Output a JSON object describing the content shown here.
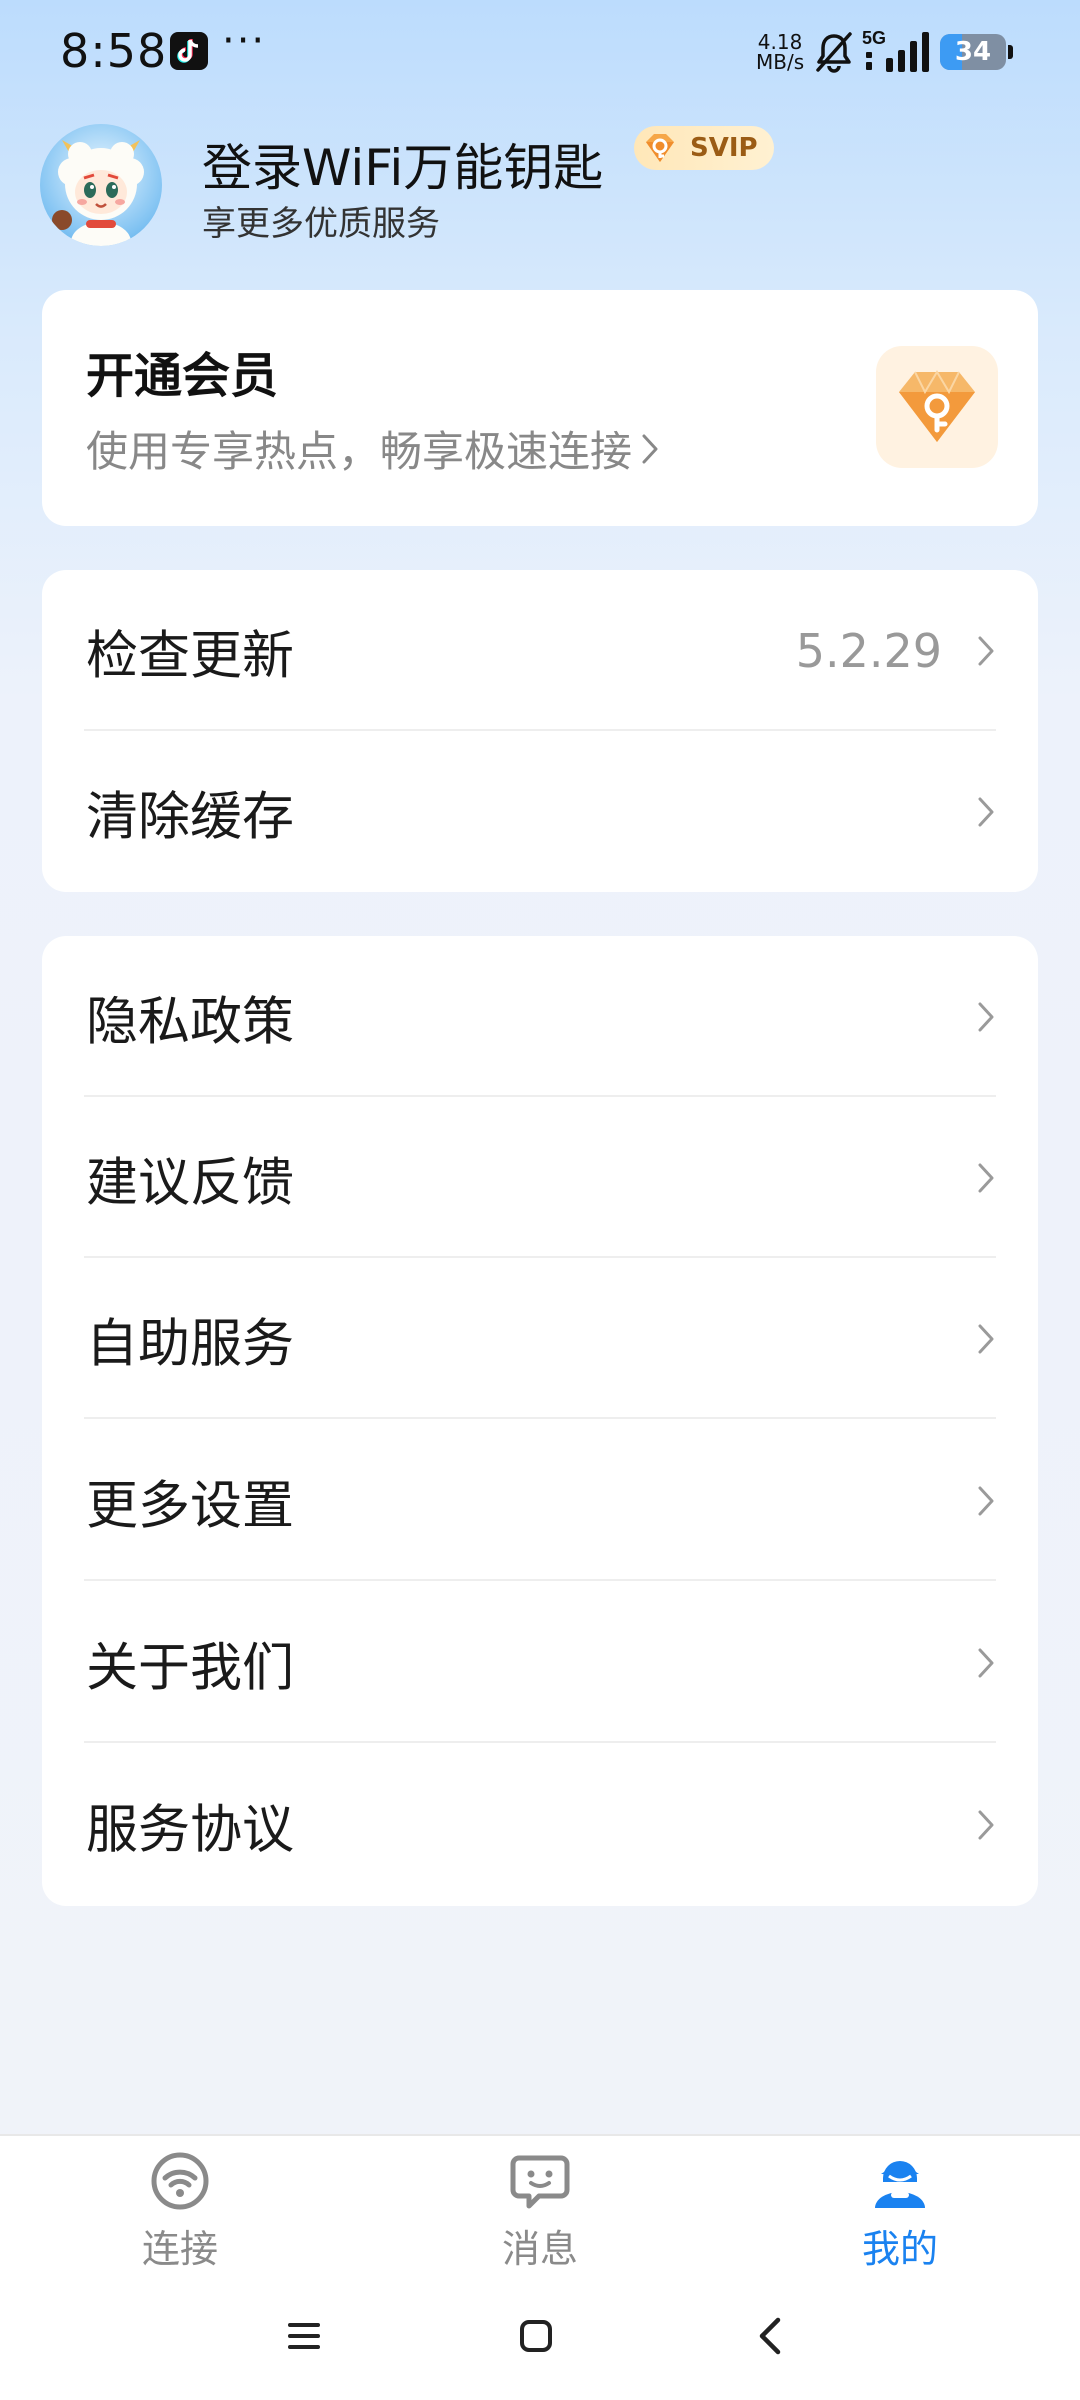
{
  "status_bar": {
    "time": "8:58",
    "more_indicator": "···",
    "net_speed_value": "4.18",
    "net_speed_unit": "MB/s",
    "network_type": "5G",
    "battery_level": 34,
    "battery_label": "34",
    "icons": [
      "tiktok-icon",
      "mute-icon",
      "signal-icon",
      "battery-icon"
    ]
  },
  "profile": {
    "name": "登录WiFi万能钥匙",
    "badge": "SVIP",
    "subtitle": "享更多优质服务"
  },
  "vip_card": {
    "title": "开通会员",
    "subtitle": "使用专享热点，畅享极速连接",
    "icon": "vip-key-gem-icon",
    "accent": "#f5a64a"
  },
  "menu_group_1": [
    {
      "label": "检查更新",
      "value": "5.2.29"
    },
    {
      "label": "清除缓存",
      "value": ""
    }
  ],
  "menu_group_2": [
    {
      "label": "隐私政策"
    },
    {
      "label": "建议反馈"
    },
    {
      "label": "自助服务"
    },
    {
      "label": "更多设置"
    },
    {
      "label": "关于我们"
    },
    {
      "label": "服务协议"
    }
  ],
  "bottom_nav": {
    "tabs": [
      {
        "label": "连接",
        "icon": "wifi-connect-icon",
        "active": false
      },
      {
        "label": "消息",
        "icon": "message-icon",
        "active": false
      },
      {
        "label": "我的",
        "icon": "profile-icon",
        "active": true
      }
    ],
    "active_color": "#1a82f0",
    "inactive_color": "#8a8a8a"
  },
  "system_nav": {
    "buttons": [
      "menu-icon",
      "home-icon",
      "back-icon"
    ]
  }
}
